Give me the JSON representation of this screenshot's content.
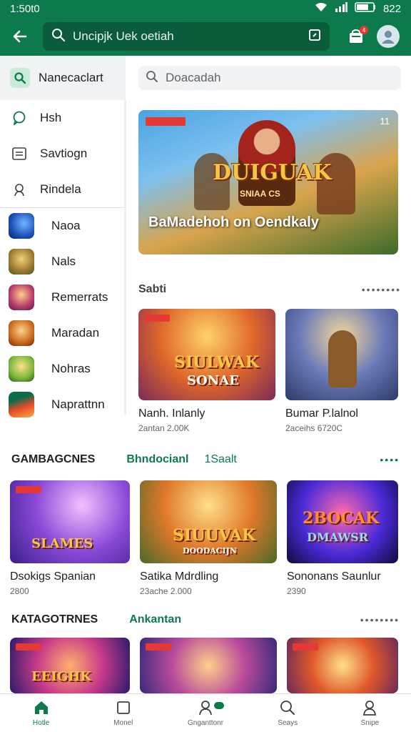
{
  "status": {
    "time": "1:50t0",
    "battery": "822"
  },
  "topbar": {
    "search_text": "Uncipjk Uek oetiah",
    "cart_badge": "4"
  },
  "sidebar": {
    "header": "Nanecaclart",
    "items": [
      {
        "label": "Hsh",
        "icon": "chat-bubble-icon"
      },
      {
        "label": "Savtiogn",
        "icon": "list-icon"
      },
      {
        "label": "Rindela",
        "icon": "person-icon"
      }
    ],
    "apps": [
      {
        "label": "Naoa",
        "color": "#1e4fb8"
      },
      {
        "label": "Nals",
        "color": "#9a7a2e"
      },
      {
        "label": "Remerrats",
        "color": "#b83a6e"
      },
      {
        "label": "Maradan",
        "color": "#c96b1e"
      },
      {
        "label": "Nohras",
        "color": "#7ab83a"
      },
      {
        "label": "Naprattnn",
        "color": "#0d6b4a"
      }
    ]
  },
  "main": {
    "search_placeholder": "Doacadah",
    "hero": {
      "art_title": "DUIGUAK",
      "art_sub": "SNIAA CS",
      "caption": "BaMadehoh on Oendkaly",
      "counter": "11"
    },
    "section1": {
      "title": "Sabti",
      "cards": [
        {
          "art": "SIULWAK",
          "art2": "SONAE",
          "title": "Nanh. Inlanly",
          "sub": "2antan 2.00K"
        },
        {
          "art": "",
          "art2": "",
          "title": "Bumar P.lalnol",
          "sub": "2aceihs 6720C"
        }
      ]
    }
  },
  "row2": {
    "title_left": "GAMBAGCNES",
    "title_green": "Bhndocianl",
    "title_green2": "1Saalt",
    "cards": [
      {
        "art": "SLAMES",
        "title": "Dsokigs Spanian",
        "sub": "2800"
      },
      {
        "art": "SIUUVAK",
        "art2": "DOODACIJN",
        "title": "Satika Mdrdling",
        "sub": "23ache 2.000"
      },
      {
        "art": "2BOCAK",
        "art2": "DMAWSR",
        "title": "Sononans Saunlur",
        "sub": "2390"
      }
    ]
  },
  "row3": {
    "title_left": "KATAGOTRNES",
    "title_green": "Ankantan",
    "cards": [
      {
        "art": "EEIGHK"
      },
      {
        "art": ""
      },
      {
        "art": ""
      }
    ]
  },
  "nav": [
    {
      "label": "Hotle",
      "icon": "home-icon"
    },
    {
      "label": "Monel",
      "icon": "square-icon"
    },
    {
      "label": "Gnganttonr",
      "icon": "person-icon"
    },
    {
      "label": "Seays",
      "icon": "search-icon"
    },
    {
      "label": "Snipe",
      "icon": "profile-icon"
    }
  ]
}
